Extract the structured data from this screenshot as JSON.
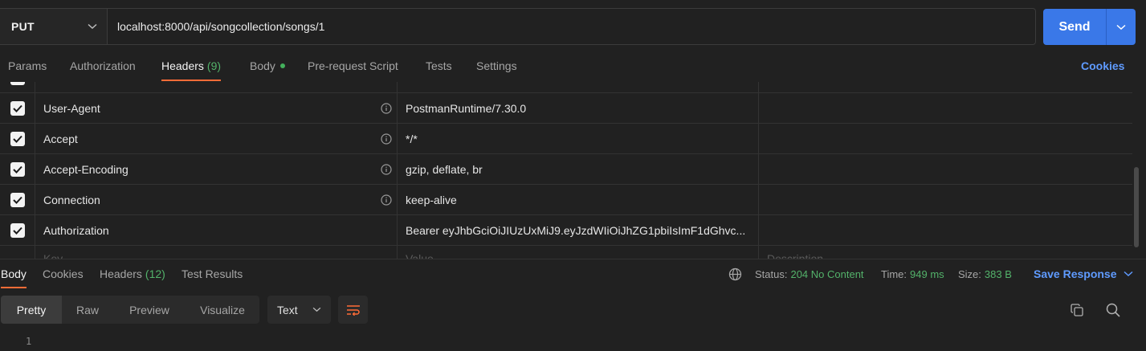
{
  "request": {
    "method": "PUT",
    "url": "localhost:8000/api/songcollection/songs/1",
    "send_label": "Send"
  },
  "tabs": [
    {
      "label": "Params"
    },
    {
      "label": "Authorization"
    },
    {
      "label": "Headers",
      "count": "(9)"
    },
    {
      "label": "Body"
    },
    {
      "label": "Pre-request Script"
    },
    {
      "label": "Tests"
    },
    {
      "label": "Settings"
    }
  ],
  "cookies_link": "Cookies",
  "headers": {
    "rows": [
      {
        "key": "User-Agent",
        "value": "PostmanRuntime/7.30.0"
      },
      {
        "key": "Accept",
        "value": "*/*"
      },
      {
        "key": "Accept-Encoding",
        "value": "gzip, deflate, br"
      },
      {
        "key": "Connection",
        "value": "keep-alive"
      },
      {
        "key": "Authorization",
        "value": "Bearer eyJhbGciOiJIUzUxMiJ9.eyJzdWIiOiJhZG1pbiIsImF1dGhvc..."
      }
    ],
    "key_placeholder": "Key",
    "value_placeholder": "Value",
    "description_placeholder": "Description"
  },
  "response": {
    "tabs": [
      {
        "label": "Body"
      },
      {
        "label": "Cookies"
      },
      {
        "label": "Headers",
        "count": "(12)"
      },
      {
        "label": "Test Results"
      }
    ],
    "status_label": "Status:",
    "status_value": "204 No Content",
    "time_label": "Time:",
    "time_value": "949 ms",
    "size_label": "Size:",
    "size_value": "383 B",
    "save_response": "Save Response",
    "formats": [
      "Pretty",
      "Raw",
      "Preview",
      "Visualize"
    ],
    "language": "Text",
    "line_number": "1"
  },
  "colors": {
    "accent_orange": "#ff6c37",
    "link_blue": "#5f9bff",
    "send_blue": "#3a78e8",
    "status_green": "#53b26a"
  }
}
